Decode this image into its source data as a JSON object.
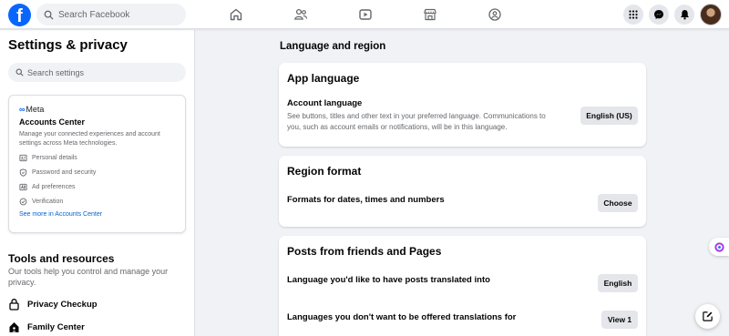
{
  "topbar": {
    "search_placeholder": "Search Facebook",
    "nav_icons": [
      "home-icon",
      "friends-icon",
      "video-icon",
      "marketplace-icon",
      "groups-icon"
    ],
    "right_icons": [
      "menu-grid-icon",
      "messenger-icon",
      "notifications-icon",
      "profile-avatar"
    ],
    "brand_color": "#0866ff"
  },
  "sidebar": {
    "title": "Settings & privacy",
    "search_placeholder": "Search settings",
    "accounts_center": {
      "brand": "Meta",
      "title": "Accounts Center",
      "description": "Manage your connected experiences and account settings across Meta technologies.",
      "items": [
        {
          "label": "Personal details",
          "icon": "id-card-icon"
        },
        {
          "label": "Password and security",
          "icon": "shield-icon"
        },
        {
          "label": "Ad preferences",
          "icon": "ad-icon"
        },
        {
          "label": "Verification",
          "icon": "check-circle-icon"
        }
      ],
      "link": "See more in Accounts Center"
    },
    "tools": {
      "title": "Tools and resources",
      "description": "Our tools help you control and manage your privacy.",
      "items": [
        {
          "label": "Privacy Checkup",
          "icon": "lock-icon"
        },
        {
          "label": "Family Center",
          "icon": "house-icon"
        }
      ]
    }
  },
  "main": {
    "heading": "Language and region",
    "app_language": {
      "title": "App language",
      "label": "Account language",
      "description": "See buttons, titles and other text in your preferred language. Communications to you, such as account emails or notifications, will be in this language.",
      "button": "English (US)"
    },
    "region_format": {
      "title": "Region format",
      "label": "Formats for dates, times and numbers",
      "button": "Choose"
    },
    "posts": {
      "title": "Posts from friends and Pages",
      "translate_label": "Language you'd like to have posts translated into",
      "translate_button": "English",
      "no_offer_label": "Languages you don't want to be offered translations for",
      "no_offer_button": "View 1"
    }
  }
}
